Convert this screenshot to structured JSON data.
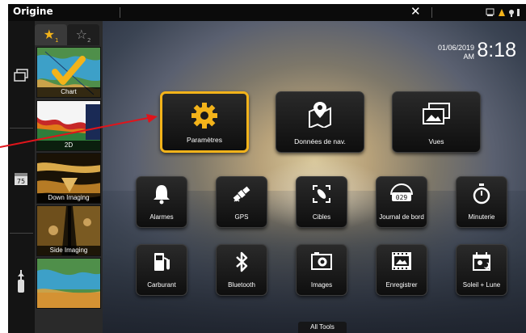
{
  "topbar": {
    "title": "Origine",
    "close_glyph": "✕",
    "status_icons": "🖧 ▲ ⚓"
  },
  "rail": {
    "buttons": [
      {
        "icon": "layers-icon",
        "glyph": "▤"
      },
      {
        "icon": "calendar-75-icon",
        "glyph": "75"
      },
      {
        "icon": "trolling-motor-icon",
        "glyph": "⍊"
      }
    ]
  },
  "favorites": {
    "tabs": [
      {
        "glyph": "★",
        "sub": "1"
      },
      {
        "glyph": "☆",
        "sub": "2"
      }
    ],
    "items": [
      {
        "label": "Chart"
      },
      {
        "label": "2D"
      },
      {
        "label": "Down Imaging"
      },
      {
        "label": "Side Imaging"
      },
      {
        "label": ""
      }
    ]
  },
  "clock": {
    "date": "01/06/2019",
    "ampm": "AM",
    "time": "8:18"
  },
  "tiles": [
    {
      "label": "Paramètres",
      "icon": "gear-icon",
      "glyph": "⚙",
      "selected": true
    },
    {
      "label": "Données de nav.",
      "icon": "map-pin-icon",
      "glyph": "⌖"
    },
    {
      "label": "Vues",
      "icon": "image-stack-icon",
      "glyph": "▨"
    },
    {
      "label": "Alarmes",
      "icon": "bell-icon",
      "glyph": "🔔"
    },
    {
      "label": "GPS",
      "icon": "satellite-icon",
      "glyph": "🛰"
    },
    {
      "label": "Cibles",
      "icon": "targets-icon",
      "glyph": "⤡"
    },
    {
      "label": "Journal de bord",
      "icon": "odometer-icon",
      "glyph": "0 2 9"
    },
    {
      "label": "Minuterie",
      "icon": "stopwatch-icon",
      "glyph": "⏱"
    },
    {
      "label": "Carburant",
      "icon": "fuel-pump-icon",
      "glyph": "⛽"
    },
    {
      "label": "Bluetooth",
      "icon": "bluetooth-icon",
      "glyph": "ᛒ"
    },
    {
      "label": "Images",
      "icon": "camera-icon",
      "glyph": "◙"
    },
    {
      "label": "Enregistrer",
      "icon": "film-icon",
      "glyph": "▣"
    },
    {
      "label": "Soleil + Lune",
      "icon": "sun-moon-calendar-icon",
      "glyph": "☼"
    }
  ],
  "footer": {
    "all_tools_label": "All Tools"
  },
  "colors": {
    "accent": "#f3b31a",
    "annotation_arrow": "#e0141b"
  }
}
